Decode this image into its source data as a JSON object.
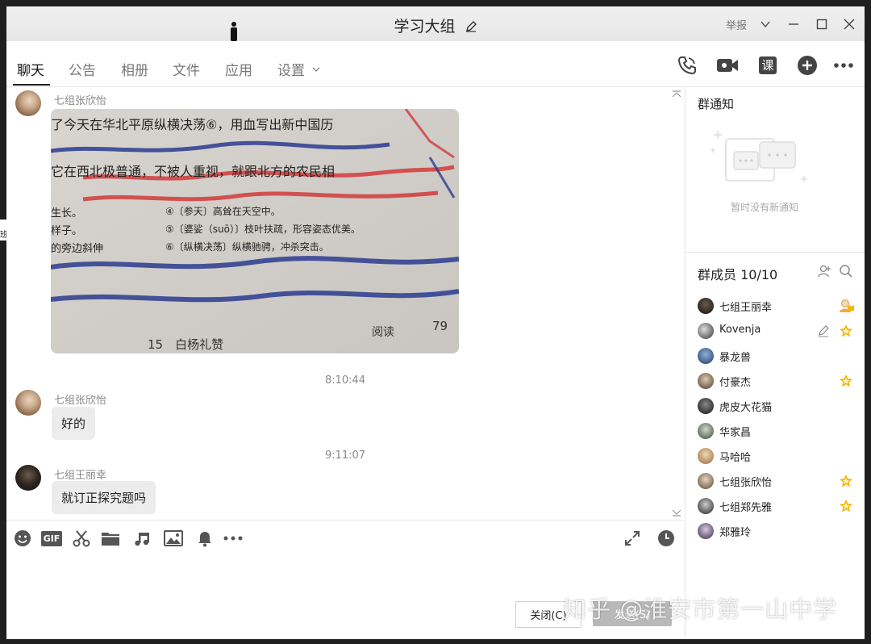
{
  "window": {
    "title": "学习大组",
    "report_label": "举报"
  },
  "tabs": [
    {
      "label": "聊天"
    },
    {
      "label": "公告"
    },
    {
      "label": "相册"
    },
    {
      "label": "文件"
    },
    {
      "label": "应用"
    },
    {
      "label": "设置"
    }
  ],
  "tab_icons": [
    "phone-icon",
    "video-call-icon",
    "class-icon",
    "add-circle-icon",
    "more-icon"
  ],
  "class_icon_char": "课",
  "messages": [
    {
      "sender": "七组张欣怡",
      "type": "image"
    },
    {
      "timestamp": "8:10:44"
    },
    {
      "sender": "七组张欣怡",
      "text": "好的"
    },
    {
      "timestamp": "9:11:07"
    },
    {
      "sender": "七组王丽幸",
      "text": "就订正探究题吗"
    }
  ],
  "photo": {
    "printed_lines": [
      "了今天在华北平原纵横决荡⑥，用血写出新中国历",
      "它在西北极普通，不被人重视，就跟北方的农民相",
      "生长。",
      "样子。",
      "的旁边斜伸"
    ],
    "notes": [
      "④〔参天〕高耸在天空中。",
      "⑤〔婆娑（suō）〕枝叶扶疏，形容姿态优美。",
      "⑥〔纵横决荡〕纵横驰骋，冲杀突击。"
    ],
    "footer_left": "15　白杨礼赞",
    "footer_right": "阅读",
    "page_number": "79"
  },
  "toolbar_icons": [
    "emoji-icon",
    "gif-icon",
    "scissors-icon",
    "folder-icon",
    "music-icon",
    "image-icon",
    "bell-icon",
    "more-icon",
    "expand-icon",
    "clock-icon"
  ],
  "toolbar_gif": "GIF",
  "buttons": {
    "close": "关闭(C)",
    "send": "发送(S)"
  },
  "sidebar": {
    "notice_title": "群通知",
    "notice_empty": "暂时没有新通知",
    "members_title": "群成员 10/10",
    "members": [
      {
        "name": "七组王丽幸",
        "badge": "owner-icon"
      },
      {
        "name": "Kovenja",
        "badge": "star-icon",
        "edit": "edit-icon"
      },
      {
        "name": "暴龙兽"
      },
      {
        "name": "付豪杰",
        "badge": "star-icon"
      },
      {
        "name": "虎皮大花猫"
      },
      {
        "name": "华家昌"
      },
      {
        "name": "马哈哈"
      },
      {
        "name": "七组张欣怡",
        "badge": "star-icon"
      },
      {
        "name": "七组郑先雅",
        "badge": "star-icon"
      },
      {
        "name": "郑雅玲"
      }
    ]
  },
  "watermark": "知乎 @淮安市第一山中学",
  "edge_text": "班",
  "colors": {
    "accent": "#1e6fd9",
    "star": "#f5b400",
    "send_button": "#b9b9b9"
  }
}
